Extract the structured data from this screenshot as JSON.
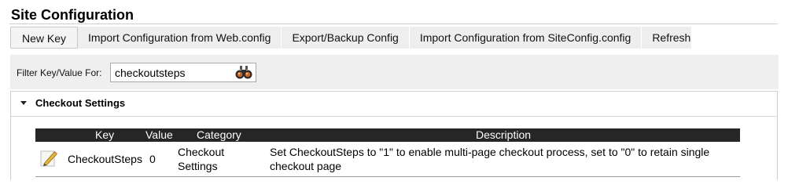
{
  "page": {
    "title": "Site Configuration"
  },
  "toolbar": {
    "buttons": [
      {
        "label": "New Key"
      },
      {
        "label": "Import Configuration from Web.config"
      },
      {
        "label": "Export/Backup Config"
      },
      {
        "label": "Import Configuration from SiteConfig.config"
      },
      {
        "label": "Refresh"
      }
    ]
  },
  "filter": {
    "label": "Filter Key/Value For:",
    "value": "checkoutsteps",
    "icon": "binoculars-icon"
  },
  "panel": {
    "title": "Checkout Settings",
    "caret_icon": "caret-down-icon",
    "grid": {
      "columns": [
        "Key",
        "Value",
        "Category",
        "Description"
      ],
      "rows": [
        {
          "icon": "edit-pencil-icon",
          "key": "CheckoutSteps",
          "value": "0",
          "category_line1": "Checkout",
          "category_line2": "Settings",
          "description_line1": "Set CheckoutSteps to \"1\" to enable multi-page checkout process, set to \"0\" to retain single",
          "description_line2": "checkout page"
        }
      ]
    }
  },
  "colors": {
    "toolbar_bg": "#eeeeee",
    "grid_header_bg": "#262626",
    "grid_header_text": "#ffffff"
  }
}
